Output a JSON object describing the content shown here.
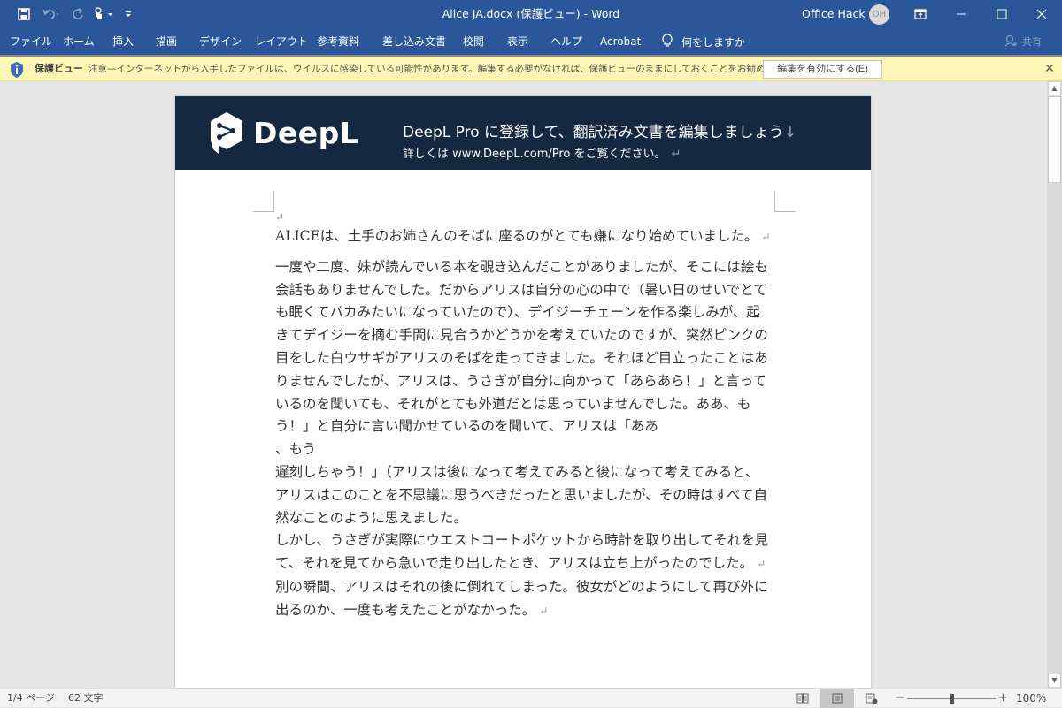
{
  "titlebar": {
    "title": "Alice JA.docx (保護ビュー)  -  Word",
    "user_name": "Office Hack",
    "user_initials": "OH",
    "icons": [
      "save-icon",
      "undo-icon",
      "redo-icon",
      "touch-mode-icon",
      "customize-qat-icon",
      "ribbon-display-options-icon",
      "minimize-icon",
      "maximize-icon",
      "close-icon"
    ]
  },
  "ribbon": {
    "tabs": [
      {
        "label": "ファイル"
      },
      {
        "label": "ホーム"
      },
      {
        "label": "挿入"
      },
      {
        "label": "描画"
      },
      {
        "label": "デザイン"
      },
      {
        "label": "レイアウト"
      },
      {
        "label": "参考資料"
      },
      {
        "label": "差し込み文書"
      },
      {
        "label": "校閲"
      },
      {
        "label": "表示"
      },
      {
        "label": "ヘルプ"
      },
      {
        "label": "Acrobat"
      }
    ],
    "tell_me": "何をしますか",
    "share": "共有"
  },
  "protected_view": {
    "title": "保護ビュー",
    "message": "注意—インターネットから入手したファイルは、ウイルスに感染している可能性があります。編集する必要がなければ、保護ビューのままにしておくことをお勧めします。",
    "enable_button": "編集を有効にする(E)",
    "accent": "#fdf6b4"
  },
  "document": {
    "banner": {
      "brand": "DeepL",
      "line1": "DeepL Pro に登録して、翻訳済み文書を編集しましょう",
      "line1_mark": "↓",
      "line2": "詳しくは www.DeepL.com/Pro をご覧ください。",
      "line2_mark": "↵",
      "background": "#142840"
    },
    "empty_mark": "↵",
    "paragraphs": [
      {
        "text": "ALICEは、土手のお姉さんのそばに座るのがとても嫌になり始めていました。",
        "mark": "↵"
      },
      {
        "text": "一度や二度、妹が読んでいる本を覗き込んだことがありましたが、そこには絵も会話もありませんでした。だからアリスは自分の心の中で（暑い日のせいでとても眠くてバカみたいになっていたので）、デイジーチェーンを作る楽しみが、起きてデイジーを摘む手間に見合うかどうかを考えていたのですが、突然ピンクの目をした白ウサギがアリスのそばを走ってきました。それほど目立ったことはありませんでしたが、アリスは、うさぎが自分に向かって「あらあら！」と言っているのを聞いても、それがとても外道だとは思っていませんでした。ああ、もう！」と自分に言い聞かせているのを聞いて、アリスは「ああ",
        "mark": ""
      },
      {
        "text": "、もう",
        "mark": ""
      },
      {
        "text": "遅刻しちゃう！」（アリスは後になって考えてみると後になって考えてみると、アリスはこのことを不思議に思うべきだったと思いましたが、その時はすべて自然なことのように思えました。",
        "mark": ""
      },
      {
        "text": "しかし、うさぎが実際にウエストコートポケットから時計を取り出してそれを見て、それを見てから急いで走り出したとき、アリスは立ち上がったのでした。",
        "mark": "↵"
      },
      {
        "text": "別の瞬間、アリスはそれの後に倒れてしまった。彼女がどのようにして再び外に出るのか、一度も考えたことがなかった。",
        "mark": "↵"
      }
    ]
  },
  "statusbar": {
    "page": "1/4 ページ",
    "words": "62 文字",
    "views": [
      "read-mode",
      "print-layout",
      "web-layout"
    ],
    "active_view": "print-layout",
    "zoom_minus": "−",
    "zoom_plus": "+",
    "zoom_level": "100%",
    "zoom_percent": 100
  }
}
